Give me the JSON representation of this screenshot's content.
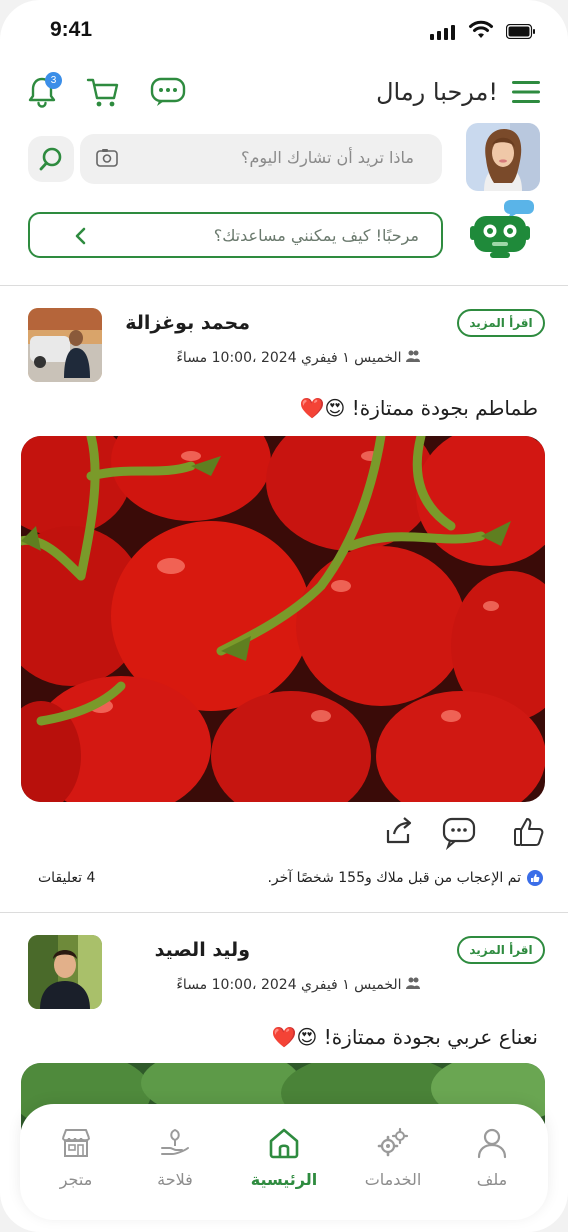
{
  "status_bar": {
    "time": "9:41"
  },
  "header": {
    "greeting": "مرحبا رمال!",
    "notifications_count": "3"
  },
  "search": {
    "placeholder": "ماذا تريد أن تشارك اليوم؟"
  },
  "assistant": {
    "prompt": "مرحبًا! كيف يمكنني مساعدتك؟"
  },
  "posts": [
    {
      "author": "محمد  بوغزالة",
      "meta": "الخميس ١ فيفري 2024 ،10:00 مساءً",
      "read_more": "اقرأ المزيد",
      "text": "طماطم بجودة ممتازة! 😍❤️",
      "likes_text": "تم الإعجاب من قبل ملاك و155 شخصًا آخر.",
      "comments_text": "4 تعليقات"
    },
    {
      "author": "وليد الصيد",
      "meta": "الخميس ١ فيفري 2024 ،10:00 مساءً",
      "read_more": "اقرأ المزيد",
      "text": "نعناع عربي بجودة ممتازة! 😍❤️"
    }
  ],
  "nav": {
    "items": [
      {
        "label": "متجر",
        "icon": "store-icon"
      },
      {
        "label": "فلاحة",
        "icon": "farming-icon"
      },
      {
        "label": "الرئيسية",
        "icon": "home-icon",
        "active": true
      },
      {
        "label": "الخدمات",
        "icon": "gears-icon"
      },
      {
        "label": "ملف",
        "icon": "user-icon"
      }
    ]
  },
  "colors": {
    "accent": "#2e8b3f",
    "badge": "#3b8ee8",
    "like": "#3b6ee8"
  }
}
